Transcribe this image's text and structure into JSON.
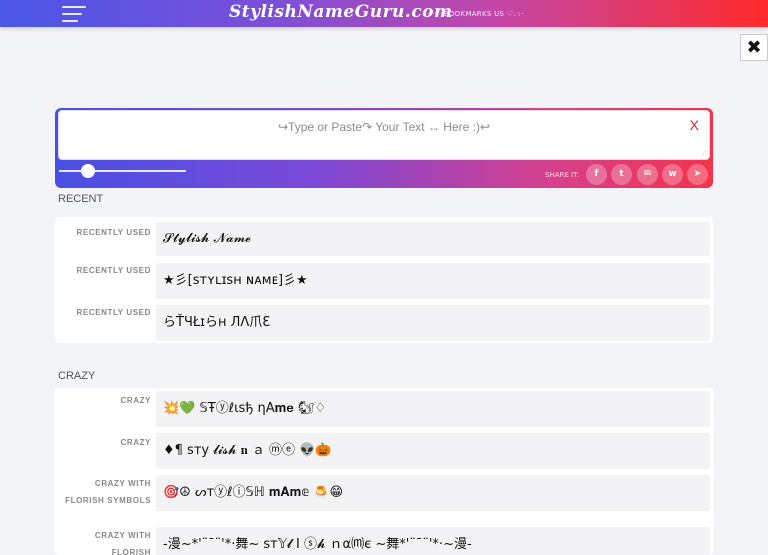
{
  "header": {
    "logo": "StylishNameGuru.com",
    "bookmark": "·:·.·♡ BOOKMARKS US ♡.·:·"
  },
  "close_button": "✖",
  "input": {
    "placeholder": "↪Type or Paste↷ Your Text ↔ Here :)↩",
    "clear": "X",
    "resize": "⋰"
  },
  "share": {
    "label": "SHARE IT:",
    "buttons": [
      "f",
      "t",
      "✉",
      "w",
      "➤"
    ]
  },
  "recent": {
    "title": "RECENT",
    "rows": [
      {
        "label": "RECENTLY USED",
        "value": "𝓢𝓽𝔂𝓵𝓲𝓼𝓱 𝓝𝓪𝓶𝓮"
      },
      {
        "label": "RECENTLY USED",
        "value": "★彡[ꜱᴛʏʟɪꜱʜ ɴᴀᴍᴇ]彡★"
      },
      {
        "label": "RECENTLY USED",
        "value": "らŤЧŁɪらн ЛΛ爪Ɛ"
      }
    ]
  },
  "crazy": {
    "title": "CRAZY",
    "rows": [
      {
        "label": "CRAZY",
        "value": "💥💚 𝕊Ŧⓨℓɩѕђ ηΑ𝐦𝐞 🐿♢"
      },
      {
        "label": "CRAZY",
        "value": "♦¶ ѕᴛу 𝓵𝓲𝓼𝓱 𝐧 ａ ⓜⓔ 👽🎃"
      },
      {
        "label": "CRAZY WITH FLORISH SYMBOLS",
        "value": "🎯☮ ᔕᴛⓨℓⓘ𝕊ℍ 𝐦𝐀𝐦𝕖 🍮😁"
      },
      {
        "label": "CRAZY WITH FLORISH",
        "value": "-漫~*'¨¯¨'*·舞~ ѕᴛ𝕐𝓵 I ⓢ𝓱 ｎα⒨є ~舞*'¨¯¨'*·~漫-"
      }
    ]
  }
}
